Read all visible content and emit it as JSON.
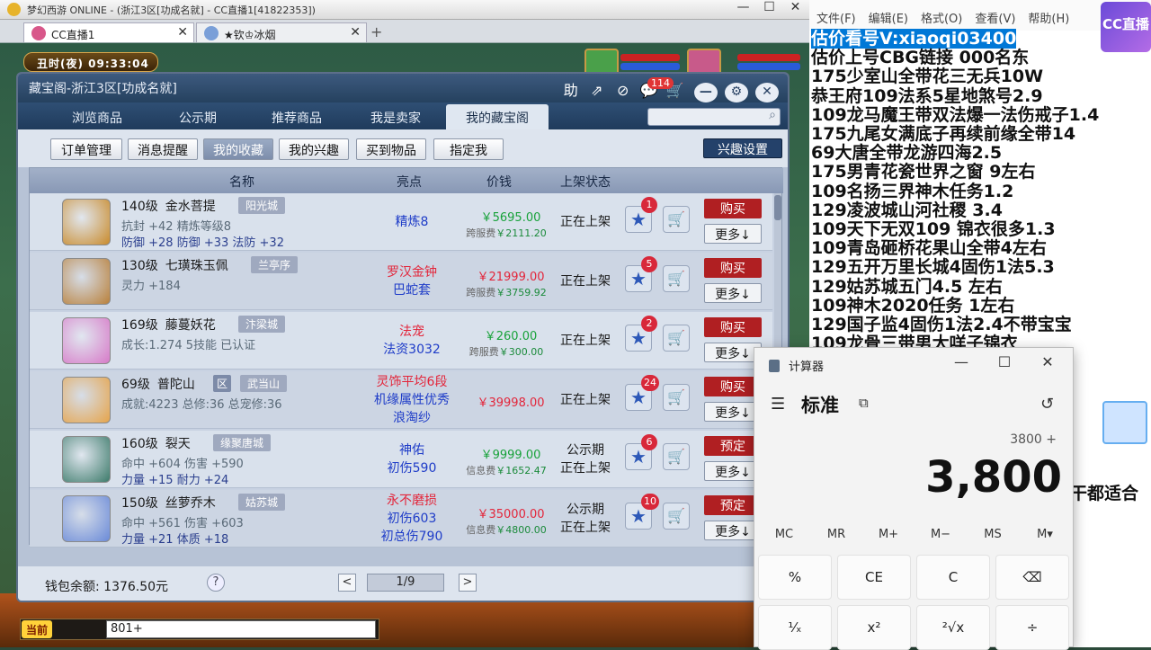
{
  "game_window": {
    "title": "梦幻西游 ONLINE - (浙江3区[功成名就] - CC直播1[41822353])",
    "controls": [
      "—",
      "☐",
      "✕"
    ],
    "tabs": [
      {
        "label": "CC直播1",
        "close": "✕"
      },
      {
        "label": "★钦♔冰烟",
        "close": "✕"
      }
    ],
    "new_tab": "+",
    "clock": "丑时(夜)  09:33:04"
  },
  "treasure": {
    "title": "藏宝阁-浙江3区[功成名就]",
    "header_icons": [
      "助",
      "⇗",
      "⊘",
      "💬",
      "🛒"
    ],
    "message_count": "114",
    "window_buttons": [
      "—",
      "⚙",
      "✕"
    ],
    "nav_tabs": [
      "浏览商品",
      "公示期",
      "推荐商品",
      "我是卖家",
      "我的藏宝阁"
    ],
    "active_nav": 4,
    "sub_buttons": [
      "订单管理",
      "消息提醒",
      "我的收藏",
      "我的兴趣",
      "买到物品",
      "指定我"
    ],
    "active_sub": 2,
    "interest_button": "兴趣设置",
    "columns": {
      "name": "名称",
      "highlight": "亮点",
      "price": "价钱",
      "status": "上架状态"
    },
    "items": [
      {
        "level": "140级",
        "name": "金水菩提",
        "server": "阳光城",
        "tag": "",
        "line1": "抗封 +42 精炼等级8",
        "line2": "防御 +28 防御 +33 法防 +32",
        "line2_blue": true,
        "highlights": [
          "精炼8"
        ],
        "hl_color": "blue",
        "price": "￥5695.00",
        "fee_label": "跨服费",
        "fee": "￥2111.20",
        "status": [
          "正在上架"
        ],
        "star_count": "1",
        "action": "购买",
        "more": "更多↓",
        "img_color": "#c98a2a"
      },
      {
        "level": "130级",
        "name": "七璜珠玉佩",
        "server": "兰亭序",
        "tag": "",
        "line1": "灵力 +184",
        "line2": "",
        "line2_blue": false,
        "highlights": [
          "罗汉金钟",
          "巴蛇套"
        ],
        "hl_color": "mixed",
        "price": "￥21999.00",
        "fee_label": "跨服费",
        "fee": "￥3759.92",
        "status": [
          "正在上架"
        ],
        "star_count": "5",
        "action": "购买",
        "more": "更多↓",
        "img_color": "#b9803a"
      },
      {
        "level": "169级",
        "name": "藤蔓妖花",
        "server": "汴梁城",
        "tag": "",
        "line1": "成长:1.274 5技能 已认证",
        "line2": "",
        "line2_blue": false,
        "highlights": [
          "法宠",
          "法资3032"
        ],
        "hl_color": "mixed",
        "price": "￥260.00",
        "fee_label": "跨服费",
        "fee": "￥300.00",
        "status": [
          "正在上架"
        ],
        "star_count": "2",
        "action": "购买",
        "more": "更多↓",
        "img_color": "#d77ac8"
      },
      {
        "level": "69级",
        "name": "普陀山",
        "server": "武当山",
        "tag": "区",
        "line1": "成就:4223 总修:36 总宠修:36",
        "line2": "",
        "line2_blue": false,
        "highlights": [
          "灵饰平均6段",
          "机缘属性优秀",
          "浪淘纱"
        ],
        "hl_color": "mixed",
        "price": "￥39998.00",
        "fee_label": "",
        "fee": "",
        "status": [
          "正在上架"
        ],
        "star_count": "24",
        "action": "购买",
        "more": "更多↓",
        "img_color": "#e6a44a"
      },
      {
        "level": "160级",
        "name": "裂天",
        "server": "缘聚唐城",
        "tag": "",
        "line1": "命中 +604 伤害 +590",
        "line2": "力量 +15 耐力 +24",
        "line2_blue": true,
        "highlights": [
          "神佑",
          "初伤590"
        ],
        "hl_color": "blue",
        "price": "￥9999.00",
        "fee_label": "信息费",
        "fee": "￥1652.47",
        "status": [
          "公示期",
          "正在上架"
        ],
        "star_count": "6",
        "action": "预定",
        "more": "更多↓",
        "img_color": "#3c7a6a"
      },
      {
        "level": "150级",
        "name": "丝萝乔木",
        "server": "姑苏城",
        "tag": "",
        "line1": "命中 +561 伤害 +603",
        "line2": "力量 +21 体质 +18",
        "line2_blue": true,
        "highlights": [
          "永不磨损",
          "初伤603",
          "初总伤790"
        ],
        "hl_color": "mixed",
        "price": "￥35000.00",
        "fee_label": "信息费",
        "fee": "￥4800.00",
        "status": [
          "公示期",
          "正在上架"
        ],
        "star_count": "10",
        "action": "预定",
        "more": "更多↓",
        "img_color": "#6a8ad8"
      }
    ],
    "wallet": "钱包余额: 1376.50元",
    "help": "?",
    "page": "1/9",
    "prev": "<",
    "next": ">"
  },
  "notepad": {
    "menu": [
      "文件(F)",
      "编辑(E)",
      "格式(O)",
      "查看(V)",
      "帮助(H)"
    ],
    "lines": [
      "估价看号V:xiaoqi03400",
      "估价上号CBG链接  000名东",
      "175少室山全带花三无兵10W",
      "恭王府109法系5星地煞号2.9",
      "109龙马魔王带双法爆一法伤戒子1.4",
      "175九尾女满底子再续前缘全带14",
      "69大唐全带龙游四海2.5",
      "175男青花瓷世界之窗   9左右",
      "109名扬三界神木任务1.2",
      "129凌波城山河社稷   3.4",
      "109天下无双109   锦衣很多1.3",
      "109青岛砸桥花果山全带4左右",
      "129五开万里长城4固伤1法5.3",
      "129姑苏城五门4.5 左右",
      "109神木2020任务   1左右",
      "129国子监4固伤1法2.4不带宝宝",
      "109龙骨三带男大咩子锦衣"
    ],
    "tail_text": "干都适合",
    "logo": "CC直播"
  },
  "calculator": {
    "title": "计算器",
    "window_controls": [
      "—",
      "☐",
      "✕"
    ],
    "menu_icon": "☰",
    "mode": "标准",
    "pin_icon": "⧉",
    "history_icon": "↺",
    "expression": "3800 +",
    "display": "3,800",
    "memory_keys": [
      "MC",
      "MR",
      "M+",
      "M−",
      "MS",
      "M▾"
    ],
    "keys_row1": [
      "%",
      "CE",
      "C",
      "⌫"
    ],
    "keys_row2": [
      "¹⁄ₓ",
      "x²",
      "²√x",
      "÷"
    ]
  },
  "chat": {
    "channel": "当前",
    "input_value": "801+"
  }
}
